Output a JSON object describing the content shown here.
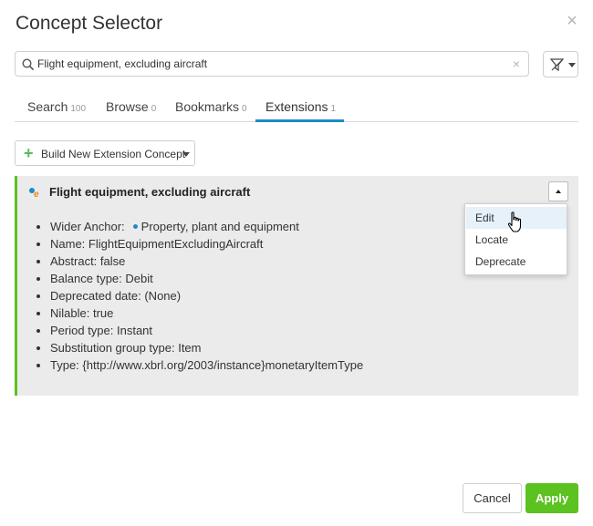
{
  "dialog": {
    "title": "Concept Selector",
    "close_icon": "close-icon"
  },
  "search": {
    "value": "Flight equipment, excluding aircraft",
    "search_icon": "search-icon",
    "clear_icon": "clear-icon",
    "filter_icon": "filter-icon"
  },
  "tabs": [
    {
      "label": "Search",
      "count": "100",
      "active": false
    },
    {
      "label": "Browse",
      "count": "0",
      "active": false
    },
    {
      "label": "Bookmarks",
      "count": "0",
      "active": false
    },
    {
      "label": "Extensions",
      "count": "1",
      "active": true
    }
  ],
  "build_button": {
    "label": "Build New Extension Concept",
    "icon": "plus-icon"
  },
  "concept": {
    "title": "Flight equipment, excluding aircraft",
    "icon": "extension-concept-icon",
    "accent_color": "#5cc21f",
    "properties": [
      {
        "label": "Wider Anchor:",
        "value": "Property, plant and equipment"
      },
      {
        "text": "Name: FlightEquipmentExcludingAircraft"
      },
      {
        "text": "Abstract: false"
      },
      {
        "text": "Balance type: Debit"
      },
      {
        "text": "Deprecated date: (None)"
      },
      {
        "text": "Nilable: true"
      },
      {
        "text": "Period type: Instant"
      },
      {
        "text": "Substitution group type: Item"
      },
      {
        "text": "Type: {http://www.xbrl.org/2003/instance}monetaryItemType"
      }
    ]
  },
  "menu": {
    "items": [
      "Edit",
      "Locate",
      "Deprecate"
    ],
    "hovered": "Edit"
  },
  "footer": {
    "cancel_label": "Cancel",
    "apply_label": "Apply",
    "apply_color": "#5cc21f"
  }
}
